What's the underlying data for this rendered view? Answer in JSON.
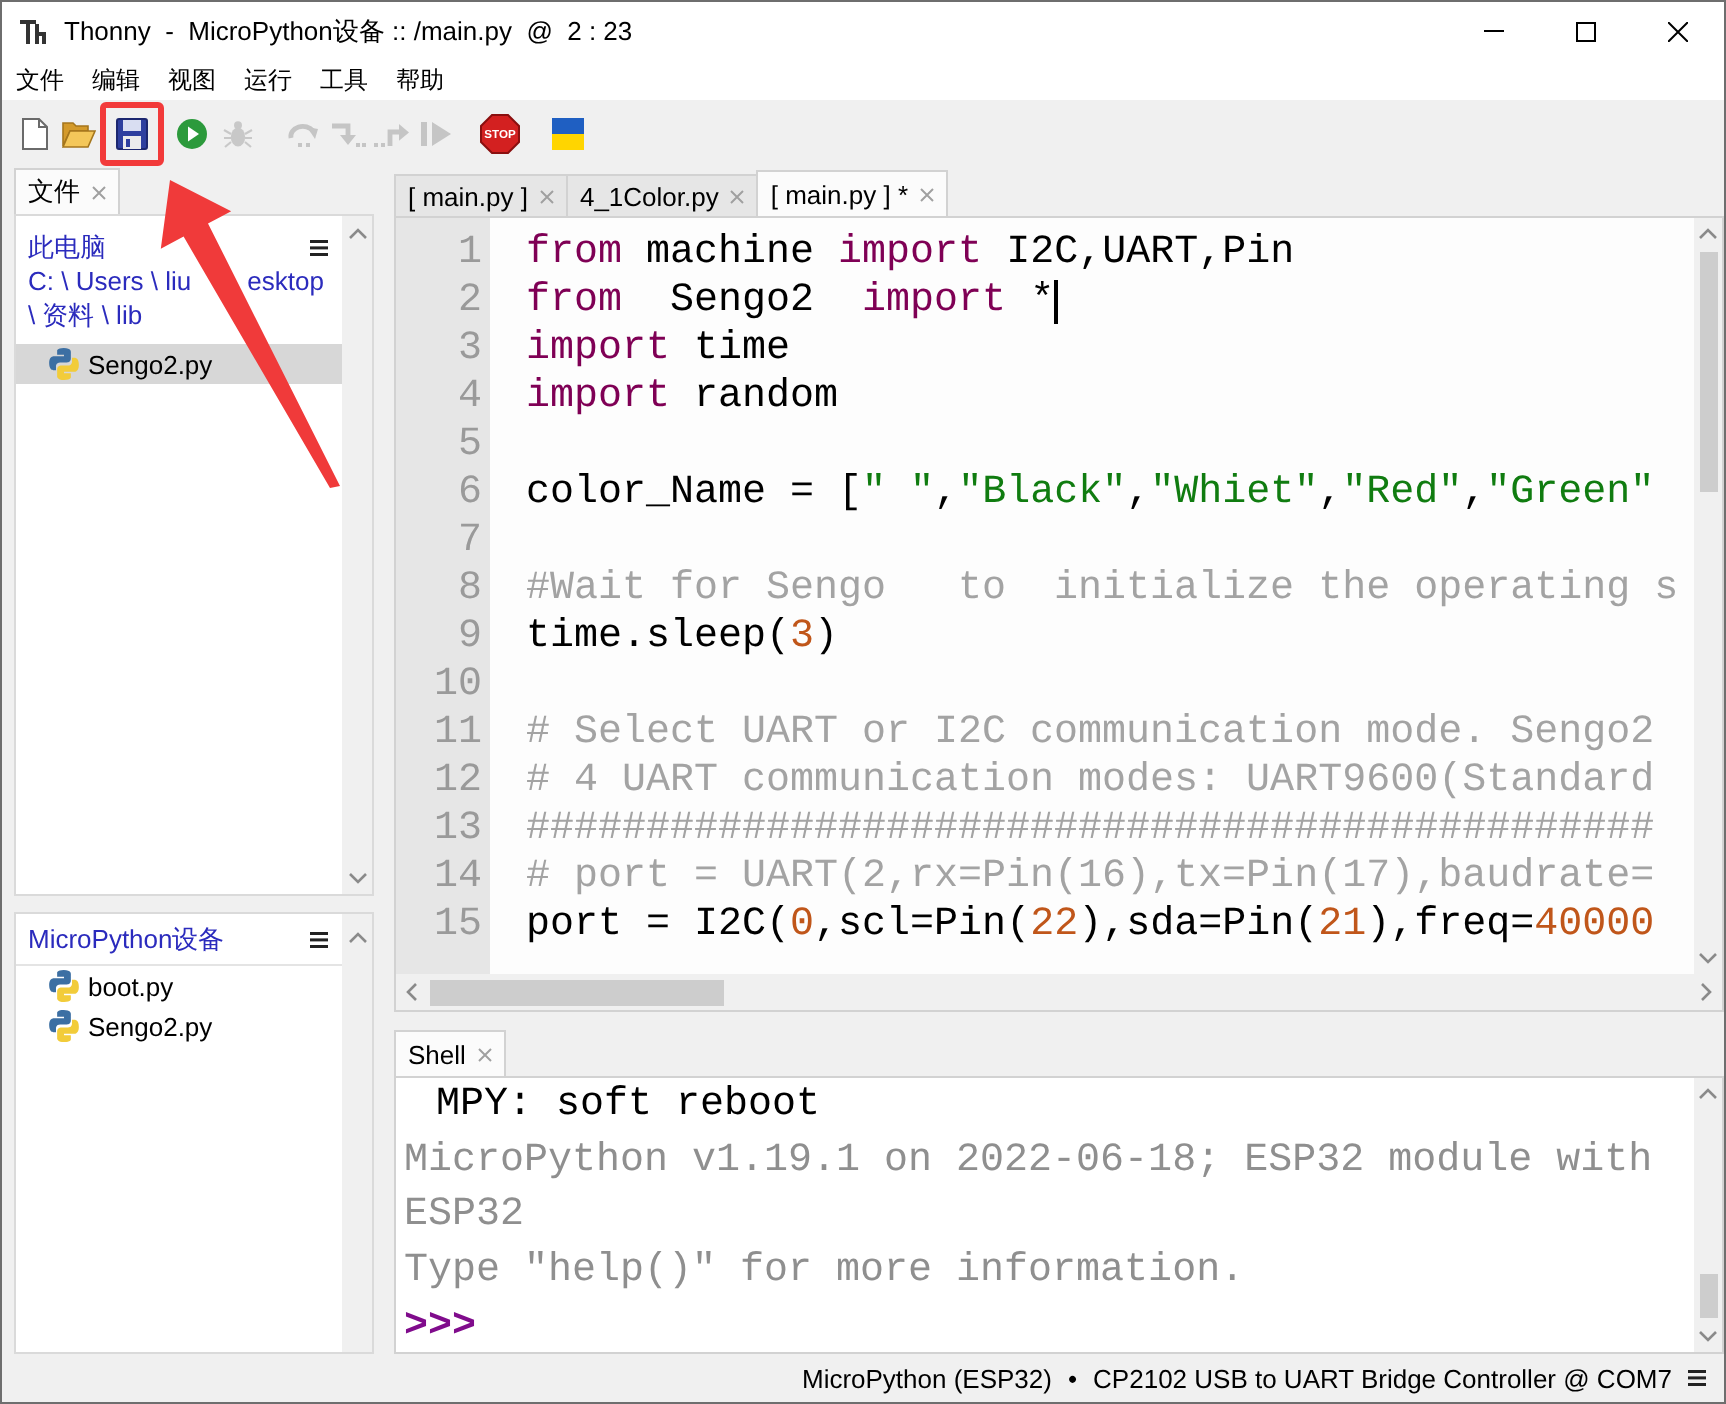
{
  "window": {
    "title": "Thonny  -  MicroPython设备 :: /main.py  @  2 : 23"
  },
  "menu": [
    "文件",
    "编辑",
    "视图",
    "运行",
    "工具",
    "帮助"
  ],
  "toolbar": [
    {
      "kind": "new",
      "disabled": false,
      "highlighted": false
    },
    {
      "kind": "open",
      "disabled": false,
      "highlighted": false
    },
    {
      "kind": "save",
      "disabled": false,
      "highlighted": true
    },
    {
      "kind": "run",
      "disabled": false,
      "highlighted": false
    },
    {
      "kind": "debug",
      "disabled": true,
      "highlighted": false
    },
    {
      "kind": "step_over",
      "disabled": true,
      "highlighted": false
    },
    {
      "kind": "step_into",
      "disabled": true,
      "highlighted": false
    },
    {
      "kind": "step_out",
      "disabled": true,
      "highlighted": false
    },
    {
      "kind": "resume",
      "disabled": true,
      "highlighted": false
    },
    {
      "kind": "stop",
      "label": "STOP",
      "disabled": false,
      "highlighted": false
    },
    {
      "kind": "flag",
      "disabled": false,
      "highlighted": false
    }
  ],
  "files_panel": {
    "tab": {
      "label": "文件",
      "selected": true
    },
    "local": {
      "heading": "此电脑",
      "path_lines": [
        [
          "C: \\ Users \\ liu",
          "esktop"
        ],
        [
          "\\ 资料 \\ lib"
        ]
      ],
      "files": [
        {
          "name": "Sengo2.py",
          "selected": true
        }
      ]
    },
    "device": {
      "heading": "MicroPython设备",
      "files": [
        {
          "name": "boot.py",
          "selected": false
        },
        {
          "name": "Sengo2.py",
          "selected": false
        }
      ]
    }
  },
  "editor": {
    "tabs": [
      {
        "label": "[ main.py ]",
        "selected": false
      },
      {
        "label": "4_1Color.py",
        "selected": false
      },
      {
        "label": "[ main.py ] *",
        "selected": true
      }
    ],
    "lines": [
      {
        "number": "1",
        "tokens": [
          {
            "kind": "keyword",
            "text": "from"
          },
          {
            "kind": "plain",
            "text": " machine "
          },
          {
            "kind": "keyword",
            "text": "import"
          },
          {
            "kind": "plain",
            "text": " I2C,UART,Pin"
          }
        ]
      },
      {
        "number": "2",
        "cursor": true,
        "tokens": [
          {
            "kind": "keyword",
            "text": "from"
          },
          {
            "kind": "plain",
            "text": "  Sengo2  "
          },
          {
            "kind": "keyword",
            "text": "import"
          },
          {
            "kind": "plain",
            "text": " *"
          }
        ]
      },
      {
        "number": "3",
        "tokens": [
          {
            "kind": "keyword",
            "text": "import"
          },
          {
            "kind": "plain",
            "text": " time"
          }
        ]
      },
      {
        "number": "4",
        "tokens": [
          {
            "kind": "keyword",
            "text": "import"
          },
          {
            "kind": "plain",
            "text": " random"
          }
        ]
      },
      {
        "number": "5"
      },
      {
        "number": "6",
        "tokens": [
          {
            "kind": "plain",
            "text": "color_Name = ["
          },
          {
            "kind": "string",
            "text": "\" \""
          },
          {
            "kind": "plain",
            "text": ","
          },
          {
            "kind": "string",
            "text": "\"Black\""
          },
          {
            "kind": "plain",
            "text": ","
          },
          {
            "kind": "string",
            "text": "\"Whiet\""
          },
          {
            "kind": "plain",
            "text": ","
          },
          {
            "kind": "string",
            "text": "\"Red\""
          },
          {
            "kind": "plain",
            "text": ","
          },
          {
            "kind": "string",
            "text": "\"Green\""
          }
        ]
      },
      {
        "number": "7"
      },
      {
        "number": "8",
        "tokens": [
          {
            "kind": "comment",
            "text": "#Wait for Sengo   to  initialize the operating s"
          }
        ]
      },
      {
        "number": "9",
        "tokens": [
          {
            "kind": "plain",
            "text": "time.sleep("
          },
          {
            "kind": "number",
            "text": "3"
          },
          {
            "kind": "plain",
            "text": ")"
          }
        ]
      },
      {
        "number": "10"
      },
      {
        "number": "11",
        "tokens": [
          {
            "kind": "comment",
            "text": "# Select UART or I2C communication mode. Sengo2"
          }
        ]
      },
      {
        "number": "12",
        "tokens": [
          {
            "kind": "comment",
            "text": "# 4 UART communication modes: UART9600(Standard"
          }
        ]
      },
      {
        "number": "13",
        "tokens": [
          {
            "kind": "comment",
            "text": "###############################################"
          }
        ]
      },
      {
        "number": "14",
        "tokens": [
          {
            "kind": "comment",
            "text": "# port = UART(2,rx=Pin(16),tx=Pin(17),baudrate="
          }
        ]
      },
      {
        "number": "15",
        "tokens": [
          {
            "kind": "plain",
            "text": "port = I2C("
          },
          {
            "kind": "number",
            "text": "0"
          },
          {
            "kind": "plain",
            "text": ",scl=Pin("
          },
          {
            "kind": "number",
            "text": "22"
          },
          {
            "kind": "plain",
            "text": "),sda=Pin("
          },
          {
            "kind": "number",
            "text": "21"
          },
          {
            "kind": "plain",
            "text": "),freq="
          },
          {
            "kind": "number",
            "text": "40000"
          }
        ]
      }
    ]
  },
  "shell": {
    "tab": {
      "label": "Shell",
      "selected": true
    },
    "lines": [
      {
        "kind": "output",
        "text": "MPY: soft reboot"
      },
      {
        "kind": "banner",
        "text": "MicroPython v1.19.1 on 2022-06-18; ESP32 module with ESP32"
      },
      {
        "kind": "banner",
        "text": "Type \"help()\" for more information."
      },
      {
        "kind": "prompt",
        "text": ">>>"
      }
    ]
  },
  "status_bar": {
    "interpreter": "MicroPython (ESP32)",
    "separator": "•",
    "connection": "CP2102 USB to UART Bridge Controller @ COM7"
  }
}
